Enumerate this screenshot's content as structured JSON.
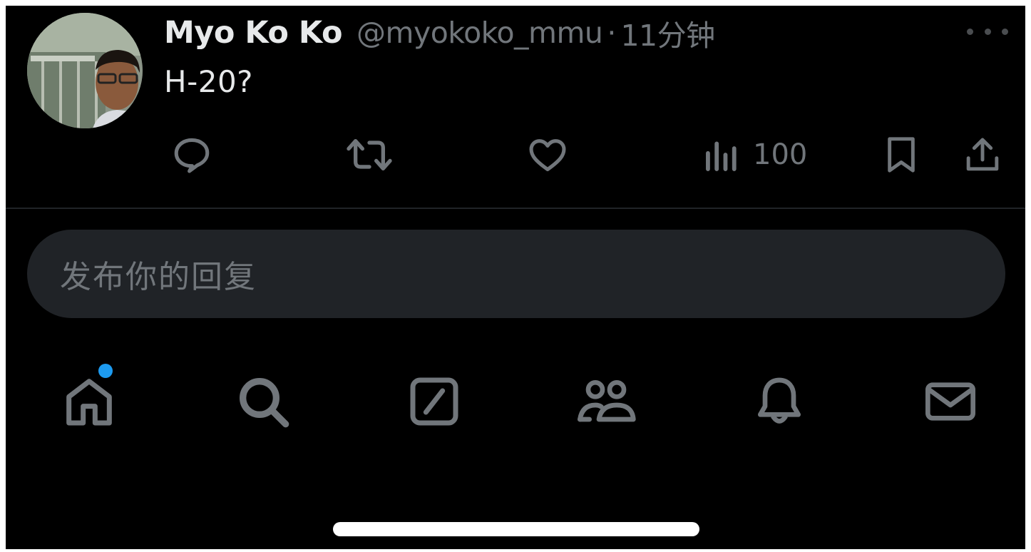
{
  "tweet": {
    "display_name": "Myo Ko Ko",
    "handle": "@myokoko_mmu",
    "separator": "·",
    "time": "11分钟",
    "text": "H-20?",
    "avatar": "profile-photo",
    "more_icon": "more-options-icon"
  },
  "actions": {
    "reply_icon": "reply-icon",
    "retweet_icon": "retweet-icon",
    "like_icon": "like-heart-icon",
    "views_icon": "views-chart-icon",
    "views_count": "100",
    "bookmark_icon": "bookmark-icon",
    "share_icon": "share-icon"
  },
  "reply_box": {
    "placeholder": "发布你的回复"
  },
  "nav": {
    "items": [
      {
        "name": "home",
        "icon": "home-icon",
        "has_badge": true
      },
      {
        "name": "search",
        "icon": "search-icon",
        "has_badge": false
      },
      {
        "name": "grok",
        "icon": "grok-icon",
        "has_badge": false
      },
      {
        "name": "communities",
        "icon": "communities-icon",
        "has_badge": false
      },
      {
        "name": "notifications",
        "icon": "bell-icon",
        "has_badge": false
      },
      {
        "name": "messages",
        "icon": "mail-icon",
        "has_badge": false
      }
    ]
  },
  "colors": {
    "background": "#000000",
    "primary_text": "#e7e9ea",
    "secondary_text": "#71767b",
    "reply_box": "#202327",
    "badge": "#1d9bf0"
  }
}
